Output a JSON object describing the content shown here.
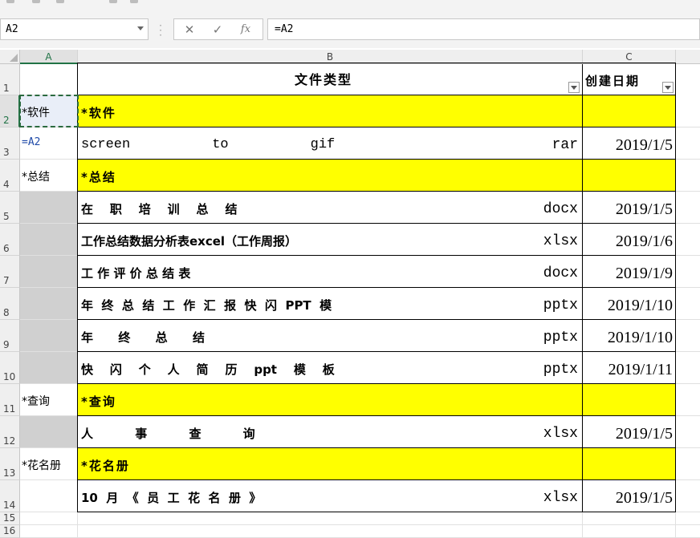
{
  "namebox": {
    "value": "A2"
  },
  "formula": {
    "cancel_icon": "✕",
    "confirm_icon": "✓",
    "fx_icon": "fx",
    "value": "=A2"
  },
  "columns": [
    "A",
    "B",
    "C"
  ],
  "header": {
    "row": "1",
    "b": "文件类型",
    "c": "创建日期"
  },
  "rows": [
    {
      "n": "2",
      "a": "*软件",
      "b": "*软件",
      "b2": "",
      "c": ""
    },
    {
      "n": "3",
      "a": "=A2",
      "b": "screen          to          gif",
      "b2": "rar",
      "c": "2019/1/5"
    },
    {
      "n": "4",
      "a": "*总结",
      "b": "*总结",
      "b2": "",
      "c": ""
    },
    {
      "n": "5",
      "a": "",
      "b": "在    职    培    训    总    结",
      "b2": "docx",
      "c": "2019/1/5"
    },
    {
      "n": "6",
      "a": "",
      "b": "工作总结数据分析表excel（工作周报）",
      "b2": "xlsx",
      "c": "2019/1/6"
    },
    {
      "n": "7",
      "a": "",
      "b": "工 作 评 价 总 结 表",
      "b2": "docx",
      "c": "2019/1/9"
    },
    {
      "n": "8",
      "a": "",
      "b": "年  终  总  结  工  作  汇  报  快  闪  PPT  模",
      "b2": "pptx",
      "c": "2019/1/10"
    },
    {
      "n": "9",
      "a": "",
      "b": "年      终      总      结",
      "b2": "pptx",
      "c": "2019/1/10"
    },
    {
      "n": "10",
      "a": "",
      "b": "快    闪    个    人    简    历    ppt    模    板",
      "b2": "pptx",
      "c": "2019/1/11"
    },
    {
      "n": "11",
      "a": "*查询",
      "b": "*查询",
      "b2": "",
      "c": ""
    },
    {
      "n": "12",
      "a": "",
      "b": "人          事          查          询",
      "b2": "xlsx",
      "c": "2019/1/5"
    },
    {
      "n": "13",
      "a": "*花名册",
      "b": "*花名册",
      "b2": "",
      "c": ""
    },
    {
      "n": "14",
      "a": "",
      "b": "10  月  《  员  工  花  名  册  》",
      "b2": "xlsx",
      "c": "2019/1/5"
    },
    {
      "n": "15",
      "a": "",
      "b": "",
      "b2": "",
      "c": ""
    },
    {
      "n": "16",
      "a": "",
      "b": "",
      "b2": "",
      "c": ""
    }
  ],
  "colors": {
    "section_fill": "#ffff00",
    "gray_fill": "#d0d0d0",
    "selection": "#217346"
  }
}
